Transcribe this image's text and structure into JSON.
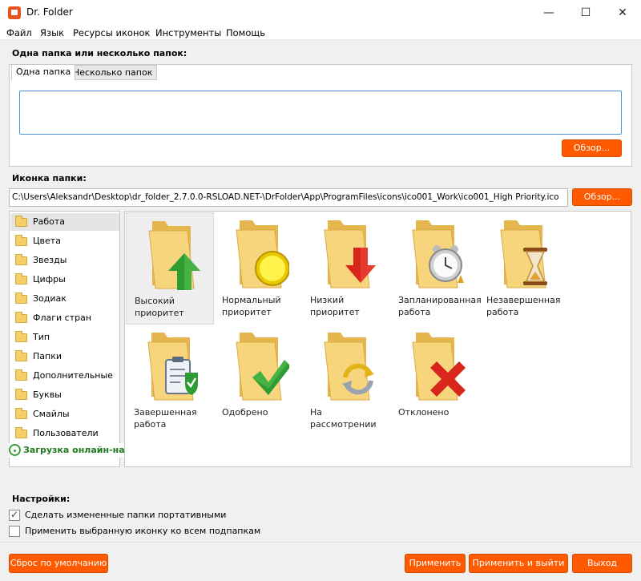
{
  "window": {
    "title": "Dr. Folder",
    "minimize": "—",
    "maximize": "☐",
    "close": "✕"
  },
  "menu": [
    "Файл",
    "Язык",
    "Ресурсы иконок",
    "Инструменты",
    "Помощь"
  ],
  "folders_section": {
    "label": "Одна папка или несколько папок:",
    "tabs": [
      "Одна папка",
      "Несколько папок"
    ],
    "input_value": "",
    "browse_label": "Обзор..."
  },
  "icon_section": {
    "label": "Иконка папки:",
    "path": "C:\\Users\\Aleksandr\\Desktop\\dr_folder_2.7.0.0-RSLOAD.NET-\\DrFolder\\App\\ProgramFiles\\icons\\ico001_Work\\ico001_High Priority.ico",
    "browse_label": "Обзор..."
  },
  "categories": [
    "Работа",
    "Цвета",
    "Звезды",
    "Цифры",
    "Зодиак",
    "Флаги стран",
    "Тип",
    "Папки",
    "Дополнительные",
    "Буквы",
    "Смайлы",
    "Пользователи"
  ],
  "selected_category": "Работа",
  "download_link": "Загрузка онлайн-наборов значков папок",
  "icons": [
    {
      "label": "Высокий приоритет",
      "overlay": "arrow-up-icon",
      "selected": true
    },
    {
      "label": "Нормальный приоритет",
      "overlay": "circle-icon",
      "selected": false
    },
    {
      "label": "Низкий приоритет",
      "overlay": "arrow-down-icon",
      "selected": false
    },
    {
      "label": "Запланированная работа",
      "overlay": "alarm-clock-icon",
      "selected": false
    },
    {
      "label": "Незавершенная работа",
      "overlay": "hourglass-icon",
      "selected": false
    },
    {
      "label": "Завершенная работа",
      "overlay": "clipboard-check-icon",
      "selected": false
    },
    {
      "label": "Одобрено",
      "overlay": "checkmark-icon",
      "selected": false
    },
    {
      "label": "На рассмотрении",
      "overlay": "refresh-icon",
      "selected": false
    },
    {
      "label": "Отклонено",
      "overlay": "red-x-icon",
      "selected": false
    }
  ],
  "settings": {
    "label": "Настройки:",
    "options": [
      {
        "text": "Сделать измененные папки портативными",
        "checked": true
      },
      {
        "text": "Применить выбранную иконку ко всем подпапкам",
        "checked": false
      }
    ]
  },
  "buttons": {
    "reset": "Сброс по умолчанию",
    "apply": "Применить",
    "apply_exit": "Применить и выйти",
    "exit": "Выход"
  },
  "colors": {
    "accent": "#ff5a00",
    "link": "#1e7b1e",
    "folder": "#f4cf6c"
  }
}
